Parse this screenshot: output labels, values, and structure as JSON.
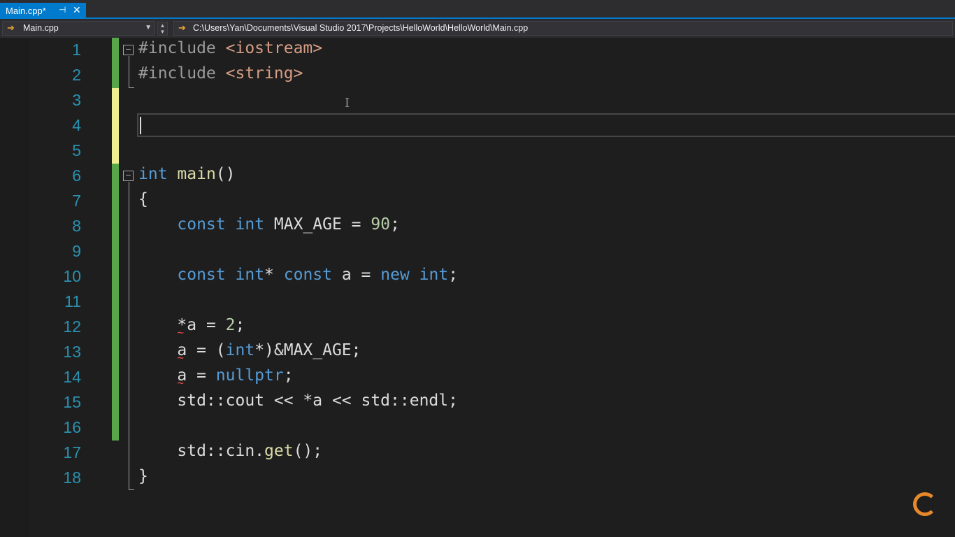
{
  "tab": {
    "label": "Main.cpp*",
    "pin": "⊣",
    "close": "✕"
  },
  "nav": {
    "scope": "Main.cpp",
    "path": "C:\\Users\\Yan\\Documents\\Visual Studio 2017\\Projects\\HelloWorld\\HelloWorld\\Main.cpp"
  },
  "colors": {
    "accent": "#007acc",
    "saved_change": "#57a64a",
    "unsaved_change": "#efef91",
    "squiggle": "#f14c4c"
  },
  "code": {
    "line_numbers": [
      "1",
      "2",
      "3",
      "4",
      "5",
      "6",
      "7",
      "8",
      "9",
      "10",
      "11",
      "12",
      "13",
      "14",
      "15",
      "16",
      "17",
      "18"
    ]
  }
}
